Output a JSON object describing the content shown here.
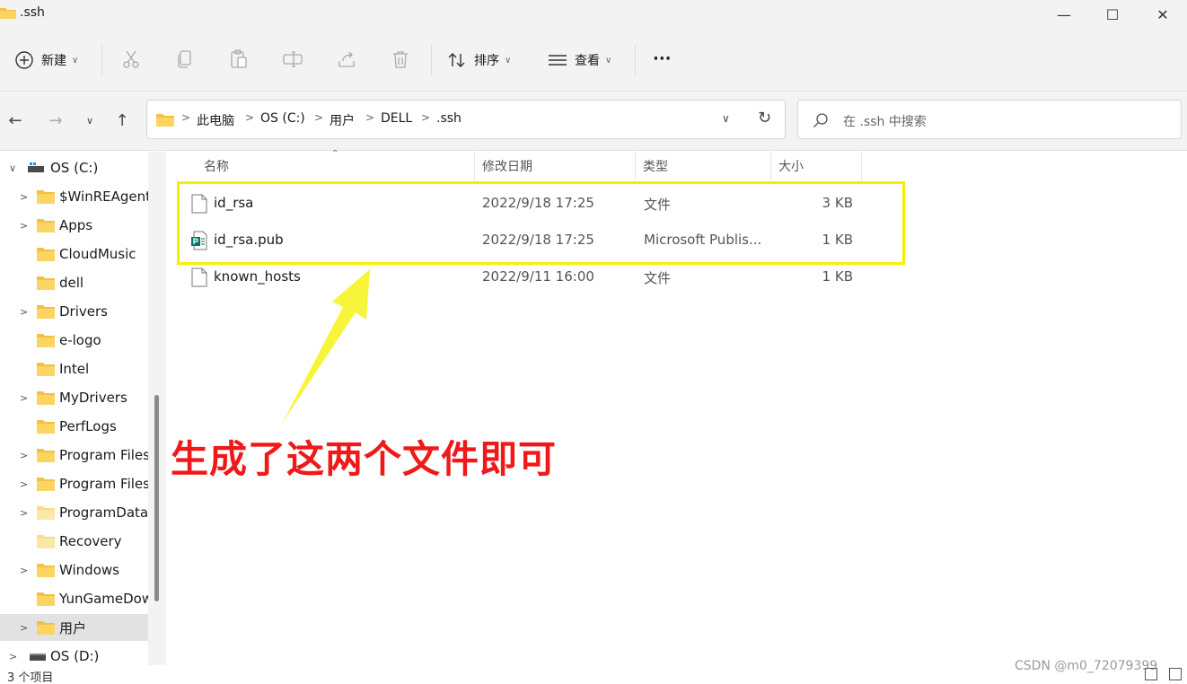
{
  "window": {
    "title": ".ssh",
    "minimize": "—",
    "maximize": "☐",
    "close": "✕"
  },
  "toolbar": {
    "new_label": "新建",
    "sort_label": "排序",
    "view_label": "查看",
    "more_label": "···"
  },
  "address": {
    "crumbs": [
      "此电脑",
      "OS (C:)",
      "用户",
      "DELL",
      ".ssh"
    ],
    "search_placeholder": "在 .ssh 中搜索"
  },
  "sidebar": {
    "items": [
      {
        "label": "OS (C:)",
        "expander": "∨"
      },
      {
        "label": "$WinREAgent",
        "expander": ">"
      },
      {
        "label": "Apps",
        "expander": ">"
      },
      {
        "label": "CloudMusic",
        "expander": ""
      },
      {
        "label": "dell",
        "expander": ""
      },
      {
        "label": "Drivers",
        "expander": ">"
      },
      {
        "label": "e-logo",
        "expander": ""
      },
      {
        "label": "Intel",
        "expander": ""
      },
      {
        "label": "MyDrivers",
        "expander": ">"
      },
      {
        "label": "PerfLogs",
        "expander": ""
      },
      {
        "label": "Program Files",
        "expander": ">"
      },
      {
        "label": "Program Files",
        "expander": ">"
      },
      {
        "label": "ProgramData",
        "expander": ">"
      },
      {
        "label": "Recovery",
        "expander": ""
      },
      {
        "label": "Windows",
        "expander": ">"
      },
      {
        "label": "YunGameDow",
        "expander": ""
      },
      {
        "label": "用户",
        "expander": ">"
      },
      {
        "label": "OS (D:)",
        "expander": ">"
      }
    ]
  },
  "columns": {
    "name": "名称",
    "modified": "修改日期",
    "type": "类型",
    "size": "大小"
  },
  "files": [
    {
      "name": "id_rsa",
      "modified": "2022/9/18 17:25",
      "type": "文件",
      "size": "3 KB"
    },
    {
      "name": "id_rsa.pub",
      "modified": "2022/9/18 17:25",
      "type": "Microsoft Publis...",
      "size": "1 KB"
    },
    {
      "name": "known_hosts",
      "modified": "2022/9/11 16:00",
      "type": "文件",
      "size": "1 KB"
    }
  ],
  "annotation": {
    "text": "生成了这两个文件即可",
    "color": "#f01818",
    "highlight_color": "#f5f000"
  },
  "status": {
    "count": "3 个项目",
    "watermark": "CSDN @m0_72079399"
  }
}
